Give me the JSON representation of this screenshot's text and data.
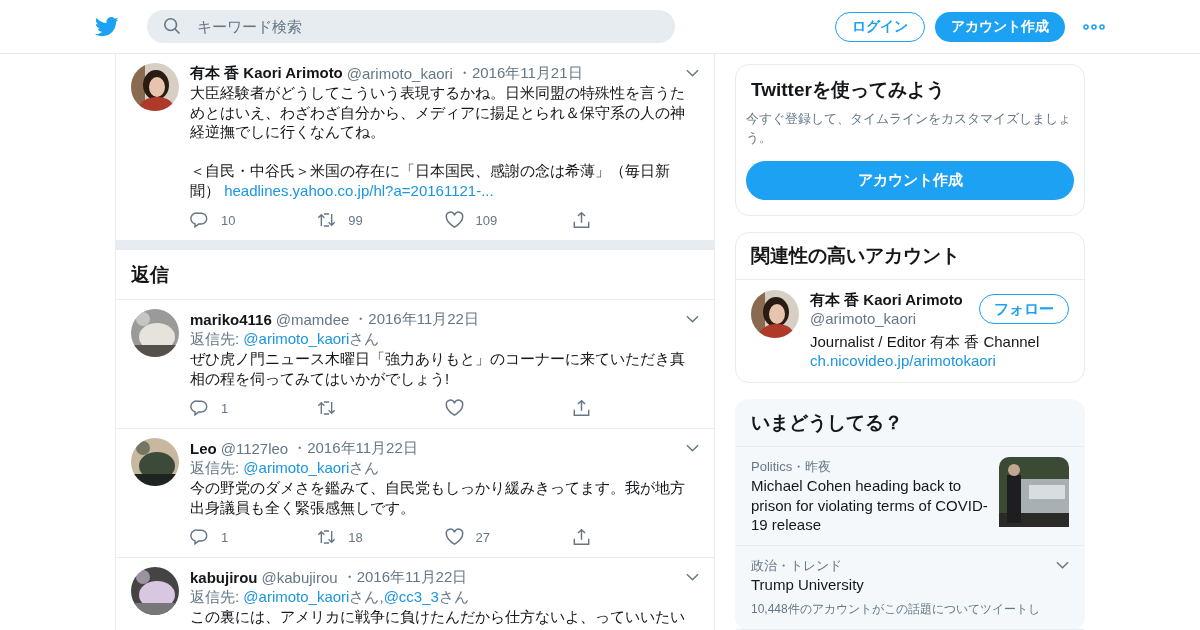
{
  "header": {
    "search": {
      "placeholder": "キーワード検索"
    },
    "login": "ログイン",
    "signup": "アカウント作成"
  },
  "main_tweet": {
    "name": "有本 香 Kaori Arimoto",
    "handle": "@arimoto_kaori",
    "date": "・2016年11月21日",
    "text": "大臣経験者がどうしてこういう表現するかね。日米同盟の特殊性を言うためとはいえ、わざわざ自分から、メディアに揚足とられ＆保守系の人の神経逆撫でしに行くなんてね。",
    "text_2": "＜自民・中谷氏＞米国の存在に「日本国民、感謝の念は希薄」（毎日新聞）",
    "link": "headlines.yahoo.co.jp/hl?a=20161121-...",
    "replies": "10",
    "retweets": "99",
    "likes": "109"
  },
  "replies_heading": "返信",
  "replies": [
    {
      "name": "mariko4116",
      "handle": "@mamdee",
      "date": "・2016年11月22日",
      "reply_label": "返信先:",
      "mentions": [
        {
          "handle": "@arimoto_kaori",
          "suffix": "さん"
        }
      ],
      "text": "ぜひ虎ノ門ニュース木曜日「強力ありもと」のコーナーに来ていただき真相の程を伺ってみてはいかがでしょう!",
      "replies": "1"
    },
    {
      "name": "Leo",
      "handle": "@1127leo",
      "date": "・2016年11月22日",
      "reply_label": "返信先:",
      "mentions": [
        {
          "handle": "@arimoto_kaori",
          "suffix": "さん"
        }
      ],
      "text": "今の野党のダメさを鑑みて、自民党もしっかり緩みきってます。我が地方出身議員も全く緊張感無しです。",
      "replies": "1",
      "retweets": "18",
      "likes": "27"
    },
    {
      "name": "kabujirou",
      "handle": "@kabujirou",
      "date": "・2016年11月22日",
      "reply_label": "返信先:",
      "mentions": [
        {
          "handle": "@arimoto_kaori",
          "suffix": "さん,"
        },
        {
          "handle": "@cc3_3",
          "suffix": "さん"
        }
      ],
      "text": "この裏には、アメリカに戦争に負けたんだから仕方ないよ、っていいたい"
    }
  ],
  "signup_card": {
    "title": "Twitterを使ってみよう",
    "description": "今すぐ登録して、タイムラインをカスタマイズしましょう。",
    "button": "アカウント作成"
  },
  "related": {
    "title": "関連性の高いアカウント",
    "name": "有本 香 Kaori Arimoto",
    "handle": "@arimoto_kaori",
    "follow": "フォロー",
    "bio": "Journalist / Editor 有本 香 Channel",
    "link": "ch.nicovideo.jp/arimotokaori"
  },
  "trends": {
    "title": "いまどうしてる？",
    "items": [
      {
        "kind": "news",
        "meta": "Politics・昨夜",
        "headline": "Michael Cohen heading back to prison for violating terms of COVID-19 release"
      },
      {
        "kind": "trend",
        "meta": "政治・トレンド",
        "headline": "Trump University",
        "count": "10,448件のアカウントがこの話題についてツイートし"
      }
    ]
  }
}
